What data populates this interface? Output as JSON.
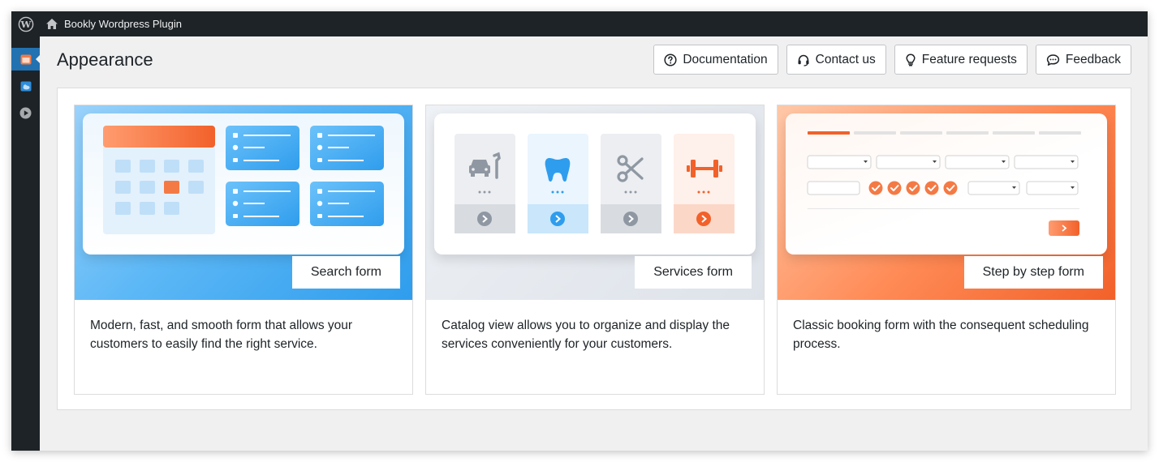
{
  "adminbar": {
    "site_name": "Bookly Wordpress Plugin",
    "logo_icon": "wordpress-logo-icon",
    "home_icon": "home-icon"
  },
  "sidebar": {
    "items": [
      {
        "icon": "bookly-calendar-icon",
        "active": true
      },
      {
        "icon": "cloud-icon",
        "active": false
      },
      {
        "icon": "play-icon",
        "active": false
      }
    ]
  },
  "page": {
    "title": "Appearance"
  },
  "toolbar": {
    "documentation": "Documentation",
    "contact": "Contact us",
    "features": "Feature requests",
    "feedback": "Feedback"
  },
  "cards": [
    {
      "label": "Search form",
      "description": "Modern, fast, and smooth form that allows your customers to easily find the right service.",
      "accent": "#2f9ded"
    },
    {
      "label": "Services form",
      "description": "Catalog view allows you to organize and display the services conveniently for your customers.",
      "accent": "#9aa4ae"
    },
    {
      "label": "Step by step form",
      "description": "Classic booking form with the consequent scheduling process.",
      "accent": "#f2612a"
    }
  ],
  "colors": {
    "adminbar": "#1d2327",
    "active_menu": "#2271b1",
    "blue": "#2f9ded",
    "orange": "#f2612a"
  }
}
